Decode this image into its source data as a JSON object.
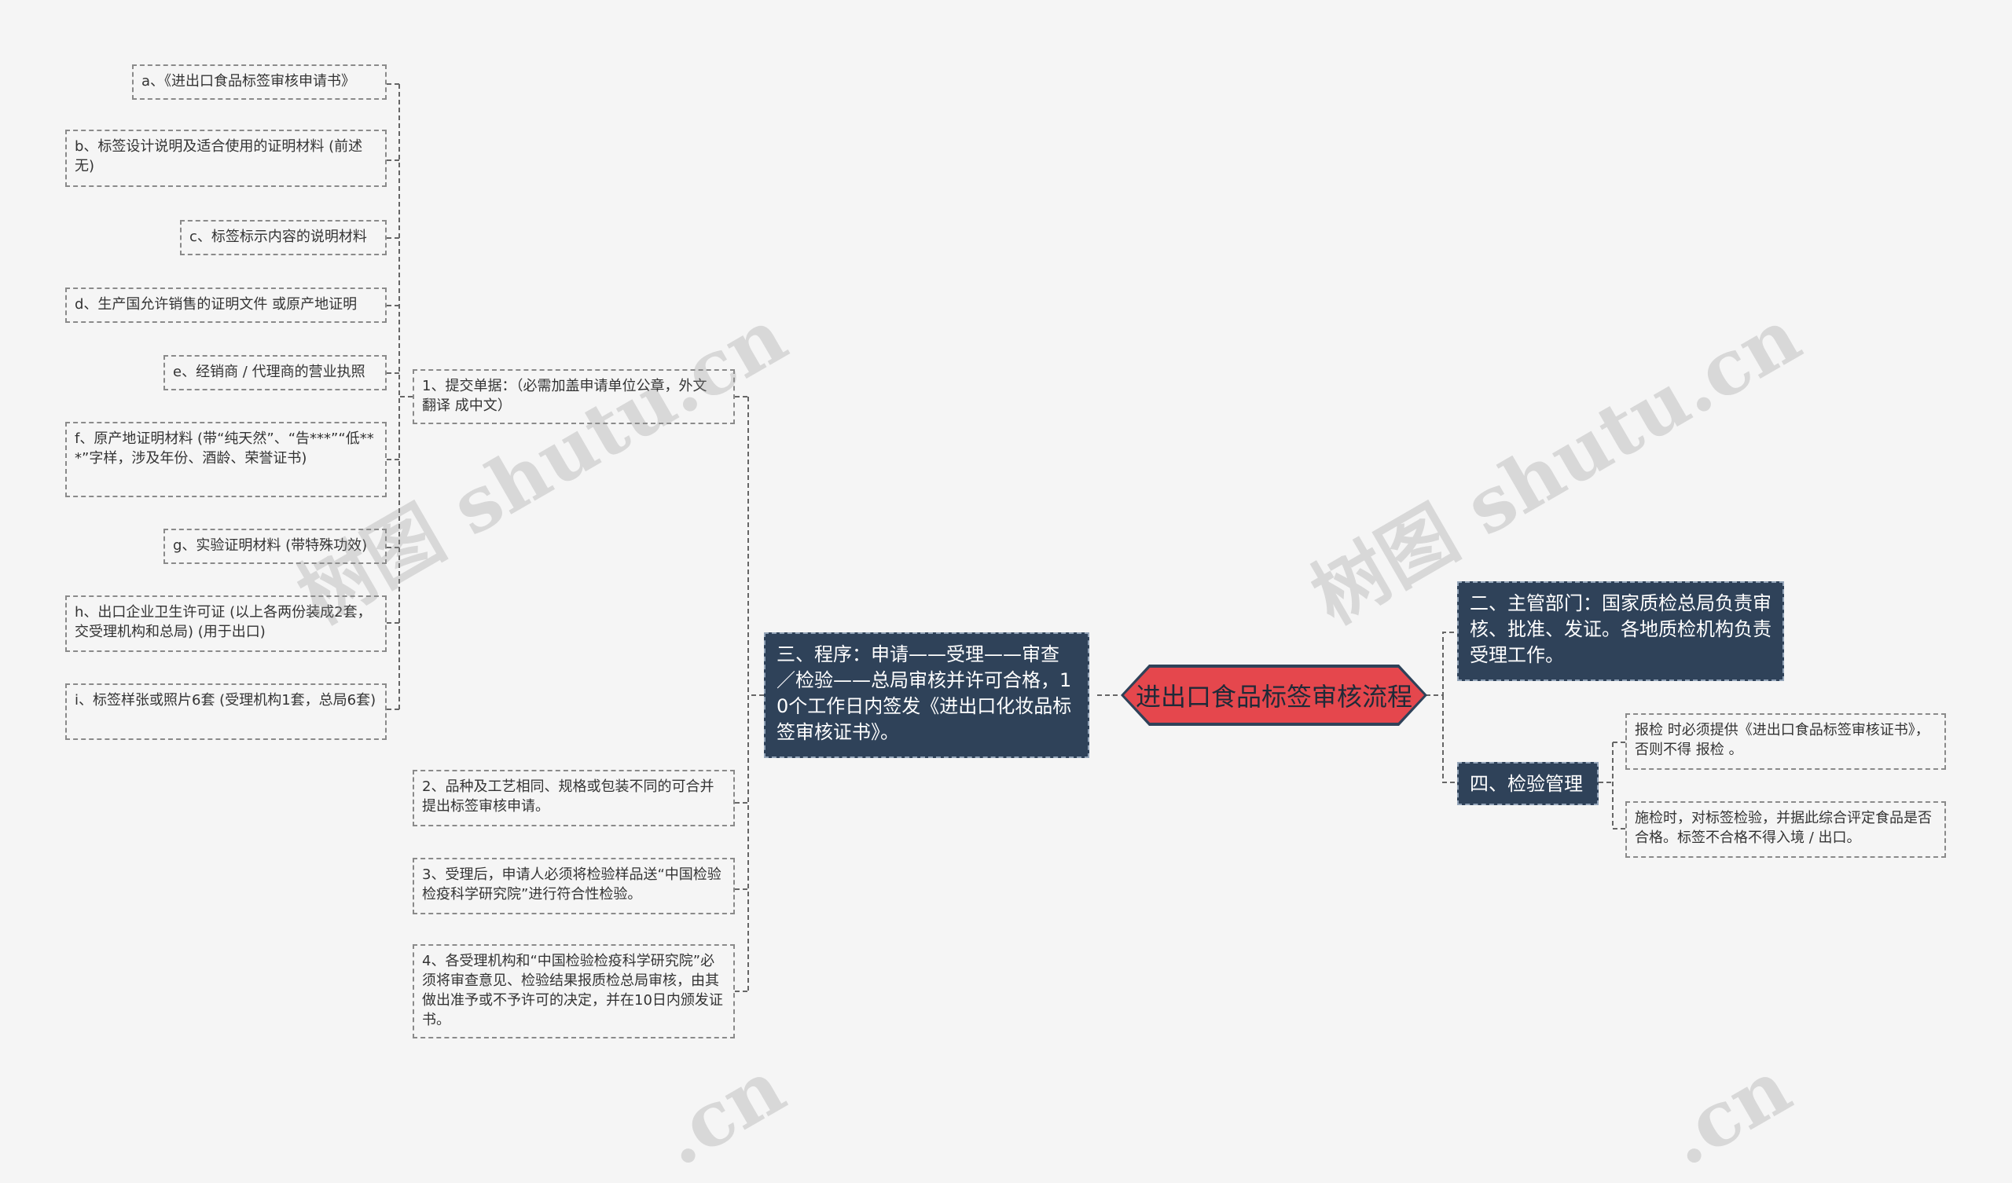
{
  "root": {
    "label": "进出口食品标签审核流程"
  },
  "branches": {
    "procedure": "三、程序：申请——受理——审查／检验——总局审核并许可合格，10个工作日内签发《进出口化妆品标签审核证书》。",
    "department": "二、主管部门：国家质检总局负责审核、批准、发证。各地质检机构负责受理工作。",
    "inspection": "四、检验管理"
  },
  "steps": [
    "1、提交单据：（必需加盖申请单位公章，外文 翻译 成中文）",
    "2、品种及工艺相同、规格或包装不同的可合并提出标签审核申请。",
    "3、受理后，申请人必须将检验样品送“中国检验检疫科学研究院”进行符合性检验。",
    "4、各受理机构和“中国检验检疫科学研究院”必须将审查意见、检验结果报质检总局审核，由其做出准予或不予许可的决定，并在10日内颁发证书。"
  ],
  "documents": [
    "a、《进出口食品标签审核申请书》",
    "b、标签设计说明及适合使用的证明材料 (前述无)",
    "c、标签标示内容的说明材料",
    "d、生产国允许销售的证明文件 或原产地证明",
    "e、经销商 / 代理商的营业执照",
    "f、原产地证明材料 (带“纯天然”、“告***”“低***”字样，涉及年份、酒龄、荣誉证书)",
    "g、实验证明材料 (带特殊功效)",
    "h、出口企业卫生许可证 (以上各两份装成2套，交受理机构和总局) (用于出口)",
    "i、标签样张或照片6套 (受理机构1套，总局6套)"
  ],
  "inspection_items": [
    "报检 时必须提供《进出口食品标签审核证书》，否则不得 报检 。",
    "施检时，对标签检验，并据此综合评定食品是否合格。标签不合格不得入境 / 出口。"
  ],
  "watermarks": [
    "树图 shutu.cn",
    "树图 shutu.cn",
    ".cn",
    ".cn"
  ],
  "colors": {
    "root_fill": "#e5474d",
    "root_border": "#2f4259",
    "branch_fill": "#2f4259",
    "line": "#666666",
    "background": "#f5f5f5"
  }
}
